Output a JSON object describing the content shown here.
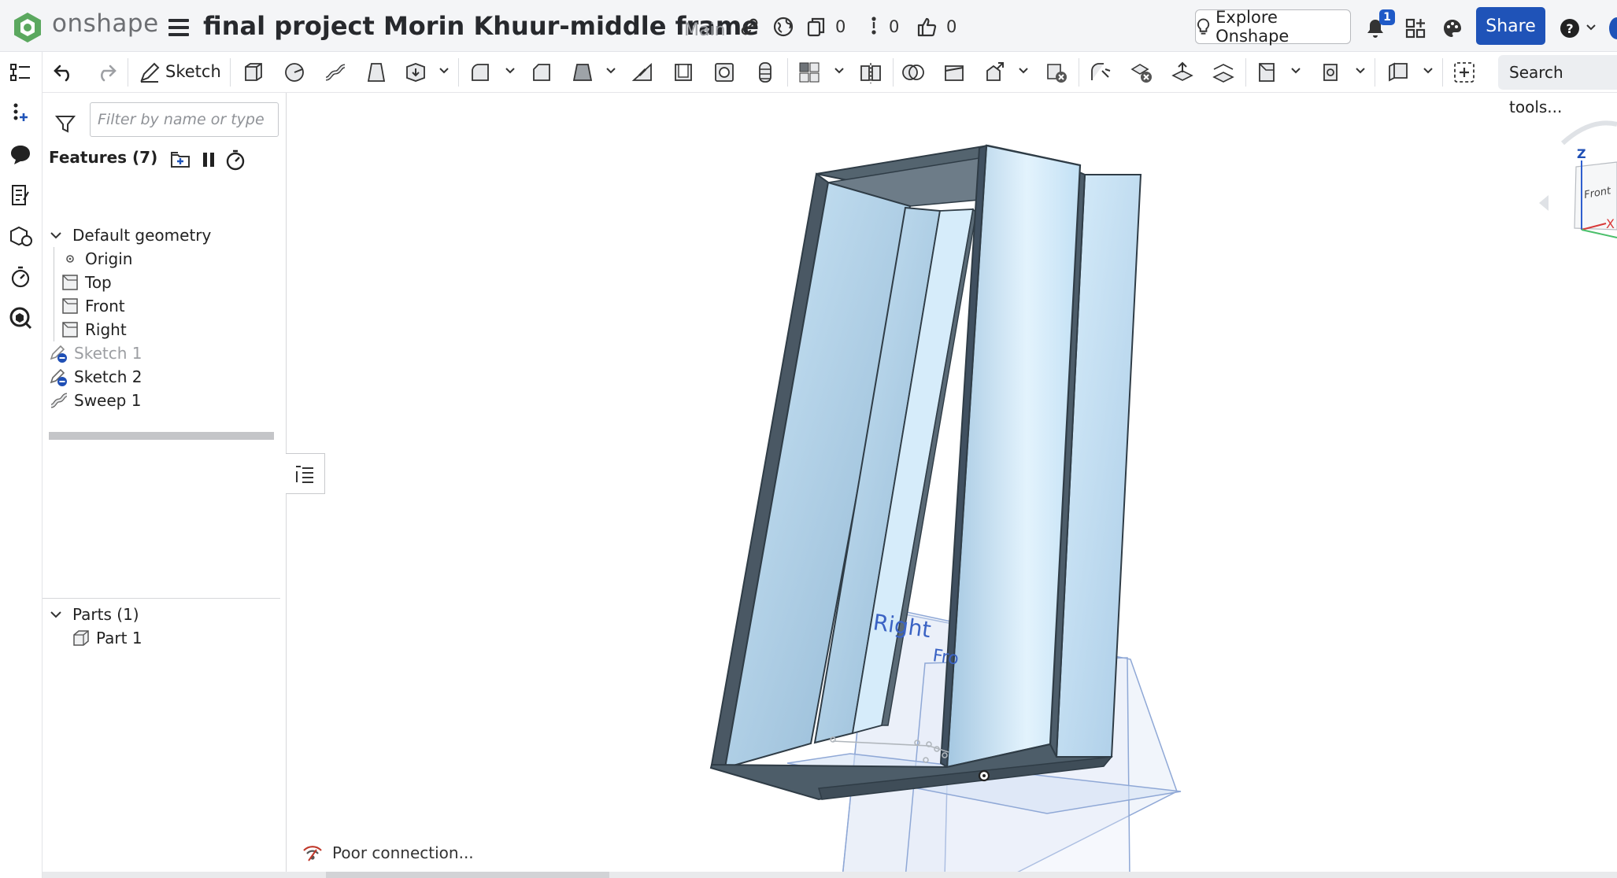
{
  "app": {
    "brand": "onshape"
  },
  "document": {
    "title": "final project Morin Khuur-middle frame",
    "branch": "Main"
  },
  "header": {
    "versions_count": "0",
    "branches_count": "0",
    "likes_count": "0",
    "explore_label": "Explore Onshape",
    "notifications_count": "1",
    "share_label": "Share",
    "help_label": "?"
  },
  "toolbar": {
    "sketch_label": "Sketch",
    "search_label": "Search tools..."
  },
  "features_panel": {
    "filter_placeholder": "Filter by name or type",
    "title": "Features (7)",
    "default_geometry": {
      "label": "Default geometry",
      "items": [
        "Origin",
        "Top",
        "Front",
        "Right"
      ]
    },
    "features": [
      {
        "label": "Sketch 1",
        "suppressed": true
      },
      {
        "label": "Sketch 2",
        "suppressed": false
      },
      {
        "label": "Sweep 1",
        "suppressed": false
      }
    ],
    "parts": {
      "label": "Parts (1)",
      "items": [
        "Part 1"
      ]
    }
  },
  "viewport": {
    "plane_labels": {
      "right": "Right",
      "front": "Fro"
    },
    "view_cube": {
      "face_label": "Front",
      "axis_z": "Z",
      "axis_x": "X"
    }
  },
  "status": {
    "connection": "Poor connection..."
  },
  "colors": {
    "accent_blue": "#1f53b8",
    "part_face": "#b9dcf2",
    "part_edge": "#4a5b68",
    "plane_blue": "#3b63c4"
  }
}
